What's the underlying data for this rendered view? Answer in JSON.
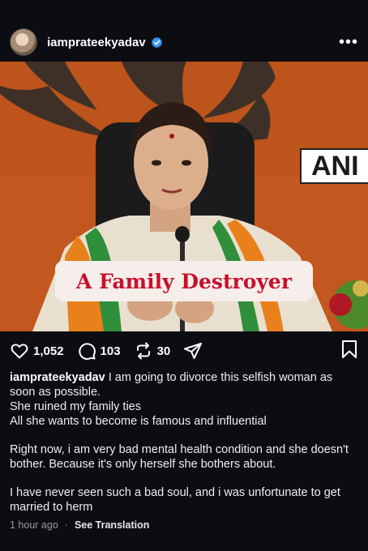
{
  "post": {
    "username": "iamprateekyadav",
    "verified": true,
    "more_icon": "more-horizontal-icon"
  },
  "media": {
    "overlay_logo_text": "ANI",
    "caption_text": "A Family Destroyer",
    "background_color": "#c2581f",
    "caption_color": "#c8102e"
  },
  "actions": {
    "likes": "1,052",
    "comments": "103",
    "reposts": "30",
    "icons": [
      "heart-icon",
      "comment-icon",
      "repost-icon",
      "share-icon",
      "bookmark-icon"
    ]
  },
  "caption": {
    "username": "iamprateekyadav",
    "line1": "I am going to divorce this selfish woman as soon as possible.",
    "line2": "She ruined my family ties",
    "line3": "All she wants to become is famous and influential",
    "para2": "Right now, i am very bad mental health condition and she doesn't bother. Because it's only herself she bothers about.",
    "para3": "I have never seen such a bad soul, and i was unfortunate to get married to herm"
  },
  "footer": {
    "timestamp": "1 hour ago",
    "separator": "·",
    "translate": "See Translation"
  }
}
